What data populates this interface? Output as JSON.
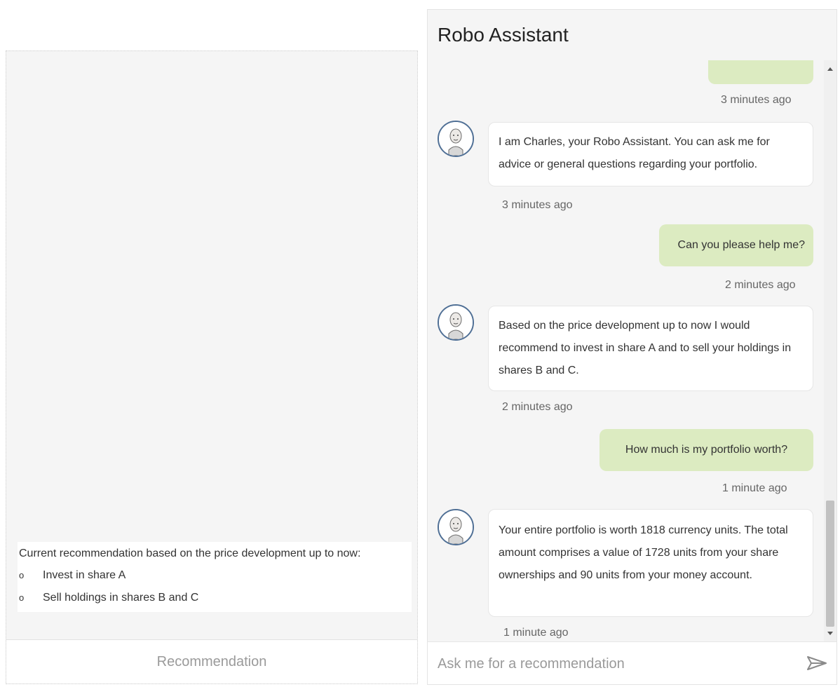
{
  "left_panel": {
    "recommendation_heading": "Current recommendation based on the price development up to now:",
    "recommendations": [
      {
        "bullet": "o",
        "text": "Invest in share A"
      },
      {
        "bullet": "o",
        "text": "Sell holdings in shares B and C"
      }
    ],
    "footer_label": "Recommendation"
  },
  "chat": {
    "title": "Robo Assistant",
    "messages": [
      {
        "sender": "user",
        "text": "",
        "time": "3 minutes ago"
      },
      {
        "sender": "bot",
        "text": "I am Charles, your Robo Assistant. You can ask me for advice or general questions regarding your portfolio.",
        "time": "3 minutes ago"
      },
      {
        "sender": "user",
        "text": "Can you please help me?",
        "time": "2 minutes ago"
      },
      {
        "sender": "bot",
        "text": "Based on the price development up to now I would recommend to invest in share A and to sell your holdings in shares B and C.",
        "time": "2 minutes ago"
      },
      {
        "sender": "user",
        "text": "How much is my portfolio worth?",
        "time": "1 minute ago"
      },
      {
        "sender": "bot",
        "text": "Your entire portfolio is worth 1818 currency units. The total amount comprises a value of 1728 units from your share ownerships and 90 units from your money account.",
        "time": "1 minute ago"
      }
    ],
    "input_placeholder": "Ask me for a recommendation"
  },
  "colors": {
    "user_bubble": "#dcebc1",
    "bot_bubble": "#ffffff",
    "panel_bg": "#f5f5f5",
    "avatar_ring": "#4f6f95"
  }
}
